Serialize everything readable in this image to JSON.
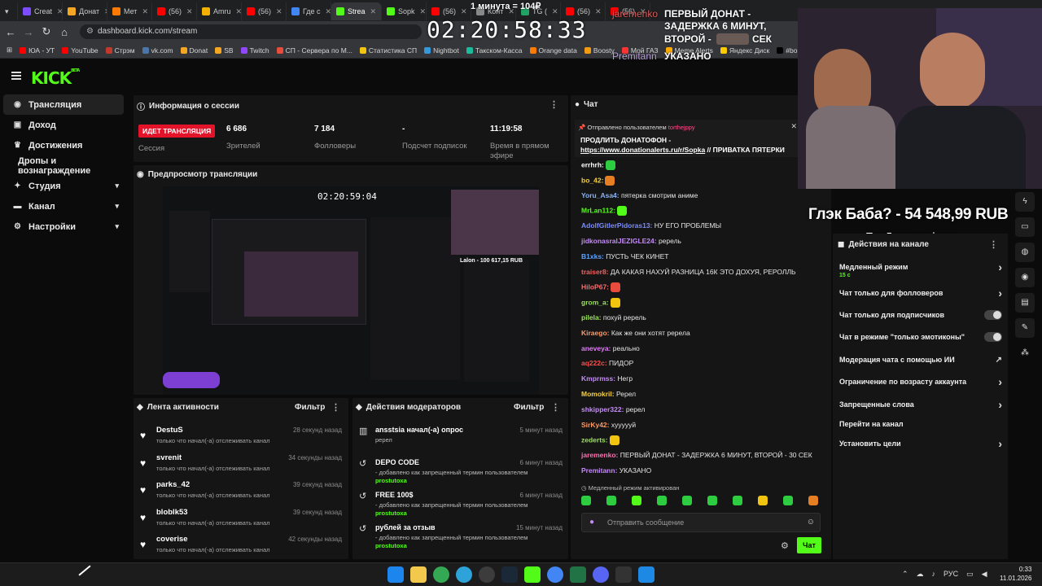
{
  "browser": {
    "tabs": [
      {
        "label": "Creat",
        "color": "#7c4dff"
      },
      {
        "label": "Донат",
        "color": "#f5a623"
      },
      {
        "label": "Мет",
        "color": "#ff7a00"
      },
      {
        "label": "(56)",
        "color": "#ff0000"
      },
      {
        "label": "Amru",
        "color": "#f6b100"
      },
      {
        "label": "(56)",
        "color": "#ff0000"
      },
      {
        "label": "Где с",
        "color": "#4285f4"
      },
      {
        "label": "Strea",
        "color": "#53fc18"
      },
      {
        "label": "Sopk",
        "color": "#53fc18"
      },
      {
        "label": "(56)",
        "color": "#ff0000"
      },
      {
        "label": "Конт",
        "color": "#888888"
      },
      {
        "label": "TG (",
        "color": "#21a366"
      },
      {
        "label": "(56)",
        "color": "#ff0000"
      },
      {
        "label": "(56)",
        "color": "#ff0000"
      }
    ],
    "url": "dashboard.kick.com/stream",
    "bookmarks": [
      "ЮА - УТ",
      "YouTube",
      "Стрэм",
      "vk.com",
      "Donat",
      "SB",
      "Twitch",
      "СП - Сервера по М...",
      "Статистика СП",
      "Nightbot",
      "Такском-Касса",
      "Orange data",
      "Boosty",
      "Мой ГАЗ",
      "Meme Alerts",
      "Яндекс Диск",
      "#bo"
    ]
  },
  "overlay": {
    "timer": "02:20:58:33",
    "price": "1 минута = 104₽",
    "donor1": "jaremenko",
    "donor2": "Premitann",
    "lines": [
      "ПЕРВЫЙ ДОНАТ -",
      "ЗАДЕРЖКА 6 МИНУТ,",
      "ВТОРОЙ -",
      "СЕК",
      "УКАЗАНО"
    ],
    "donation": "Глэк Баба? - 54 548,99 RUB",
    "donation_sub": "Топ 5 донатофона"
  },
  "brand": {
    "logo": "KICK",
    "beta": "BETA",
    "accent": "#53fc18"
  },
  "sidebar": {
    "items": [
      {
        "label": "Трансляция",
        "icon": "broadcast-icon",
        "chev": ""
      },
      {
        "label": "Доход",
        "icon": "money-icon",
        "chev": ""
      },
      {
        "label": "Достижения",
        "icon": "trophy-icon",
        "chev": ""
      },
      {
        "label": "Дропы и вознаграждение",
        "icon": "",
        "chev": ""
      },
      {
        "label": "Студия",
        "icon": "studio-icon",
        "chev": "▾"
      },
      {
        "label": "Канал",
        "icon": "channel-icon",
        "chev": "▾"
      },
      {
        "label": "Настройки",
        "icon": "gear-icon",
        "chev": "▾"
      }
    ]
  },
  "session": {
    "title": "Информация о сессии",
    "live": "ИДЕТ ТРАНСЛЯЦИЯ",
    "live_label": "Сессия",
    "stats": [
      {
        "value": "6 686",
        "label": "Зрителей"
      },
      {
        "value": "7 184",
        "label": "Фолловеры"
      },
      {
        "value": "-",
        "label": "Подсчет подписок"
      },
      {
        "value": "11:19:58",
        "label": "Время в прямом эфире"
      }
    ]
  },
  "preview": {
    "title": "Предпросмотр трансляции",
    "inner_timer": "02:20:59:04",
    "inner_donation": "Lalon - 100 617,15 RUB"
  },
  "activity": {
    "title": "Лента активности",
    "filter": "Фильтр",
    "items": [
      {
        "name": "DestuS",
        "sub": "только что начал(-а) отслеживать канал",
        "time": "28 секунд назад"
      },
      {
        "name": "svrenit",
        "sub": "только что начал(-а) отслеживать канал",
        "time": "34 секунды назад"
      },
      {
        "name": "parks_42",
        "sub": "только что начал(-а) отслеживать канал",
        "time": "39 секунд назад"
      },
      {
        "name": "bloblk53",
        "sub": "только что начал(-а) отслеживать канал",
        "time": "39 секунд назад"
      },
      {
        "name": "coverise",
        "sub": "только что начал(-а) отслеживать канал",
        "time": "42 секунды назад"
      }
    ]
  },
  "modactions": {
    "title": "Действия модераторов",
    "filter": "Фильтр",
    "items": [
      {
        "icon": "poll-icon",
        "glyph": "▥",
        "name": "ansstsia начал(-а) опрос",
        "sub": "ререл",
        "by": "",
        "time": "5 минут назад"
      },
      {
        "icon": "undo-icon",
        "glyph": "↺",
        "name": "DEPO CODE",
        "sub": "- добавлено как запрещенный термин пользователем",
        "by": "prostutoxa",
        "time": "6 минут назад"
      },
      {
        "icon": "undo-icon",
        "glyph": "↺",
        "name": "FREE 100$",
        "sub": "- добавлено как запрещенный термин пользователем",
        "by": "prostutoxa",
        "time": "6 минут назад"
      },
      {
        "icon": "undo-icon",
        "glyph": "↺",
        "name": "рублей за отзыв",
        "sub": "- добавлено как запрещенный термин пользователем",
        "by": "prostutoxa",
        "time": "15 минут назад"
      }
    ]
  },
  "chat": {
    "title": "Чат",
    "pinned_by_label": "Отправлено пользователем",
    "pinned_by": "torthejppy",
    "pinned_text1": "ПРОДЛИТЬ ДОНАТОФОН -",
    "pinned_link": "https://www.donationalerts.ru/r/Sopka",
    "pinned_rest": " // ПРИВАТКА ПЯТЕРКИ",
    "messages": [
      {
        "user": "errhrh:",
        "color": "#ffffff",
        "text": "",
        "emote": "#2ecc40"
      },
      {
        "user": "bo_42:",
        "color": "#f5d142",
        "text": "",
        "emote": "#e67e22"
      },
      {
        "user": "Yoru_Asa4:",
        "color": "#8ab4f8",
        "text": " пятерка смотрим аниме",
        "emote": ""
      },
      {
        "user": "MrLan112:",
        "color": "#53fc18",
        "text": "",
        "emote": "#53fc18"
      },
      {
        "user": "AdolfGitlerPidoras13:",
        "color": "#7b8cff",
        "text": " НУ ЕГО ПРОБЛЕМЫ",
        "emote": ""
      },
      {
        "user": "jidkonasralJEZIGLE24:",
        "color": "#c58af9",
        "text": " ререль",
        "emote": ""
      },
      {
        "user": "B1xks:",
        "color": "#5ea3ff",
        "text": " ПУСТЬ ЧЕК КИНЕТ",
        "emote": ""
      },
      {
        "user": "traiser8:",
        "color": "#ff5c5c",
        "text": " ДА КАКАЯ НАХУЙ РАЗНИЦА 16К ЭТО ДОХУЯ, РЕРОЛЛЬ",
        "emote": ""
      },
      {
        "user": "HiloP67:",
        "color": "#ff6b6b",
        "text": "",
        "emote": "#e74c3c"
      },
      {
        "user": "grom_a:",
        "color": "#9be15d",
        "text": "",
        "emote": "#f1c40f"
      },
      {
        "user": "pilela:",
        "color": "#9be15d",
        "text": " похуй ререль",
        "emote": ""
      },
      {
        "user": "Kiraego:",
        "color": "#ff9966",
        "text": " Как же они хотят ререла",
        "emote": ""
      },
      {
        "user": "aneveya:",
        "color": "#e57aff",
        "text": " реально",
        "emote": ""
      },
      {
        "user": "aq222c:",
        "color": "#ff4d4d",
        "text": " ПИДОР",
        "emote": ""
      },
      {
        "user": "Kmprmss:",
        "color": "#c58af9",
        "text": " Негр",
        "emote": ""
      },
      {
        "user": "Momokril:",
        "color": "#f5d142",
        "text": " Ререл",
        "emote": ""
      },
      {
        "user": "shkipper322:",
        "color": "#c58af9",
        "text": " ререл",
        "emote": ""
      },
      {
        "user": "SirKy42:",
        "color": "#ff9966",
        "text": " хуууууй",
        "emote": ""
      },
      {
        "user": "zederts:",
        "color": "#9be15d",
        "text": "",
        "emote": "#f1c40f"
      },
      {
        "user": "jaremenko:",
        "color": "#ff6fb1",
        "text": " ПЕРВЫЙ ДОНАТ - ЗАДЕРЖКА 6 МИНУТ, ВТОРОЙ - 30 СЕК",
        "emote": ""
      },
      {
        "user": "Premitann:",
        "color": "#c58af9",
        "text": " УКАЗАНО",
        "emote": ""
      }
    ],
    "slow_mode": "Медленный режим активирован",
    "emote_colors": [
      "#2ecc40",
      "#2ecc40",
      "#53fc18",
      "#2ecc40",
      "#2ecc40",
      "#2ecc40",
      "#2ecc40",
      "#f1c40f",
      "#2ecc40",
      "#e67e22"
    ],
    "placeholder": "Отправить сообщение",
    "send": "Чат"
  },
  "channel_actions": {
    "title": "Действия на канале",
    "items": [
      {
        "label": "Медленный режим",
        "sub": "15 с",
        "control": "chev"
      },
      {
        "label": "Чат только для фолловеров",
        "sub": "",
        "control": "chev"
      },
      {
        "label": "Чат только для подписчиков",
        "sub": "",
        "control": "toggle"
      },
      {
        "label": "Чат в режиме \"только эмотиконы\"",
        "sub": "",
        "control": "toggle"
      },
      {
        "label": "Модерация чата с помощью ИИ",
        "sub": "",
        "control": "ext"
      },
      {
        "label": "Ограничение по возрасту аккаунта",
        "sub": "",
        "control": "chev"
      },
      {
        "label": "Запрещенные слова",
        "sub": "",
        "control": "chev"
      },
      {
        "label": "Перейти на канал",
        "sub": "",
        "control": ""
      },
      {
        "label": "Установить цели",
        "sub": "",
        "control": "chev"
      }
    ]
  },
  "taskbar": {
    "lang": "РУС",
    "time": "0:33",
    "date": "11.01.2026"
  }
}
